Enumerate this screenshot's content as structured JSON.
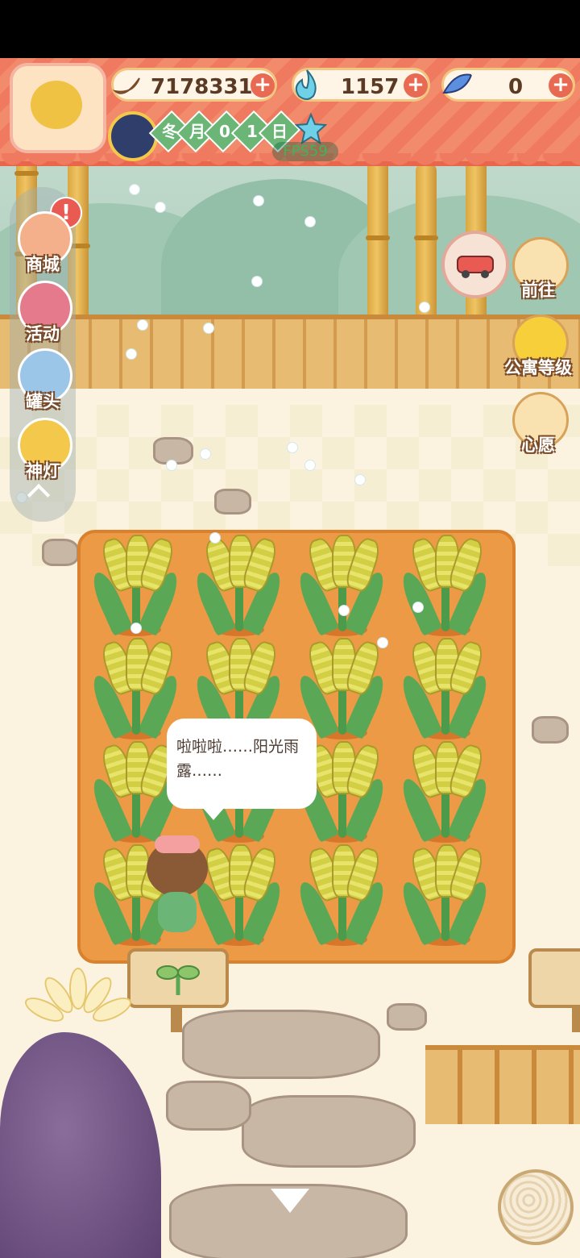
{
  "resources": {
    "bananas": "7178331",
    "flame": "1157",
    "gem_fish": "0"
  },
  "calendar": {
    "season": "冬",
    "month_label": "月",
    "digit_1": "0",
    "digit_2": "1",
    "day_label": "日"
  },
  "fps": "FPS59",
  "left_menu": [
    {
      "label": "商城",
      "icon": "shop-icon"
    },
    {
      "label": "活动",
      "icon": "gift-icon"
    },
    {
      "label": "罐头",
      "icon": "can-icon"
    },
    {
      "label": "神灯",
      "icon": "lamp-icon"
    }
  ],
  "right_menu": [
    {
      "label": "前往",
      "icon": "map-pin-icon"
    },
    {
      "label": "公寓等级",
      "icon": "cat-badge-icon"
    },
    {
      "label": "心愿",
      "icon": "heart-book-icon"
    }
  ],
  "speech": "啦啦啦……阳光雨露……",
  "colors": {
    "hud": "#f07a5f",
    "field": "#ec9a45",
    "plant": "#5aa855",
    "grain": "#d2cf45"
  }
}
